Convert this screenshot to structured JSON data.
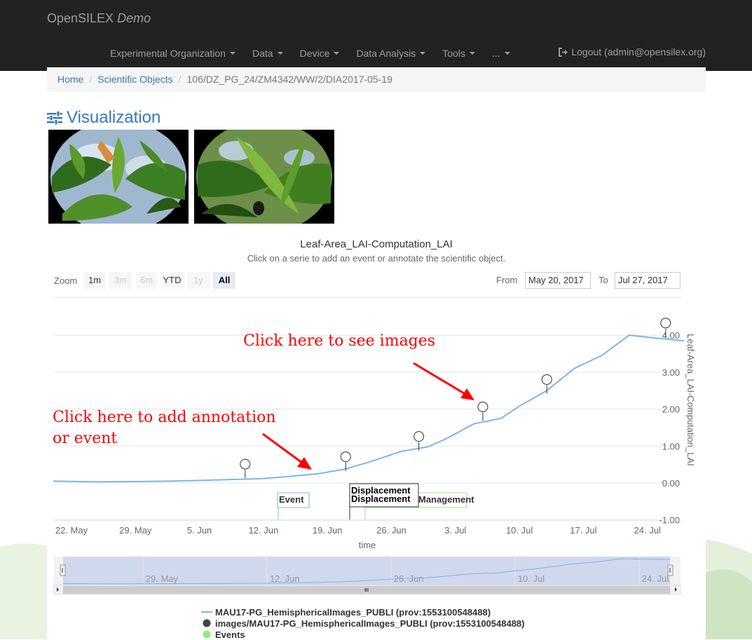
{
  "navbar": {
    "brand": "OpenSILEX",
    "brand_suffix": "Demo",
    "items": [
      {
        "label": "Experimental Organization"
      },
      {
        "label": "Data"
      },
      {
        "label": "Device"
      },
      {
        "label": "Data Analysis"
      },
      {
        "label": "Tools"
      },
      {
        "label": "..."
      }
    ],
    "logout": "Logout (admin@opensilex.org)"
  },
  "breadcrumb": {
    "home": "Home",
    "objects": "Scientific Objects",
    "current": "106/DZ_PG_24/ZM4342/WW/2/DIA2017-05-19"
  },
  "visualization": {
    "title": "Visualization"
  },
  "chart": {
    "title": "Leaf-Area_LAI-Computation_LAI",
    "subtitle": "Click on a serie to add an event or annotate the scientific object.",
    "zoom_label": "Zoom",
    "zoom_buttons": [
      "1m",
      "3m",
      "6m",
      "YTD",
      "1y",
      "All"
    ],
    "from_label": "From",
    "from_value": "May 20, 2017",
    "to_label": "To",
    "to_value": "Jul 27, 2017",
    "annotation_images": "Click here to see images",
    "annotation_event_line1": "Click here to add annotation",
    "annotation_event_line2": "or event",
    "colors": {
      "line": "#7cb5ec",
      "events": "#90ed7d",
      "navigator_fill": "#c9d4ec",
      "annotation": "#ff0000"
    }
  },
  "chart_data": {
    "type": "line",
    "title": "Leaf-Area_LAI-Computation_LAI",
    "xlabel": "time",
    "ylabel": "Leaf-Area_LAI-Computation_LAI",
    "ylim": [
      -1,
      4.3
    ],
    "y_ticks": [
      "-1.00",
      "0.00",
      "1.00",
      "2.00",
      "3.00",
      "4.00"
    ],
    "x_ticks": [
      "22. May",
      "29. May",
      "5. Jun",
      "12. Jun",
      "19. Jun",
      "26. Jun",
      "3. Jul",
      "10. Jul",
      "17. Jul",
      "24. Jul"
    ],
    "navigator_ticks": [
      "29. May",
      "12. Jun",
      "26. Jun",
      "10. Jul",
      "24. Jul"
    ],
    "series": [
      {
        "name": "MAU17-PG_HemisphericalImages_PUBLI (prov:1553100548488)",
        "x": [
          "2017-05-20",
          "2017-05-25",
          "2017-05-30",
          "2017-06-04",
          "2017-06-08",
          "2017-06-12",
          "2017-06-15",
          "2017-06-18",
          "2017-06-21",
          "2017-06-24",
          "2017-06-27",
          "2017-06-30",
          "2017-07-02",
          "2017-07-05",
          "2017-07-08",
          "2017-07-10",
          "2017-07-13",
          "2017-07-16",
          "2017-07-19",
          "2017-07-22",
          "2017-07-25",
          "2017-07-28"
        ],
        "values": [
          0.05,
          0.03,
          0.04,
          0.06,
          0.09,
          0.12,
          0.18,
          0.25,
          0.38,
          0.6,
          0.85,
          0.98,
          1.2,
          1.6,
          1.75,
          2.08,
          2.5,
          3.1,
          3.45,
          4.0,
          3.92,
          3.85
        ]
      },
      {
        "name": "images/MAU17-PG_HemisphericalImages_PUBLI (prov:1553100548488)",
        "x": [
          "2017-06-10",
          "2017-06-21",
          "2017-06-29",
          "2017-07-06",
          "2017-07-13",
          "2017-07-26"
        ],
        "values": [
          0.13,
          0.33,
          0.88,
          1.68,
          2.42,
          3.95
        ]
      }
    ],
    "events": [
      {
        "label": "Event",
        "date": "2017-06-13"
      },
      {
        "label": "Displacement",
        "date": "2017-06-21"
      },
      {
        "label": "Displacement",
        "date": "2017-06-21"
      },
      {
        "label": "Management",
        "date": "2017-06-23"
      }
    ]
  },
  "legend": [
    {
      "name": "MAU17-PG_HemisphericalImages_PUBLI (prov:1553100548488)",
      "symbol": "line",
      "color": "#7cb5ec"
    },
    {
      "name": "images/MAU17-PG_HemisphericalImages_PUBLI (prov:1553100548488)",
      "symbol": "circle",
      "color": "#434348"
    },
    {
      "name": "Events",
      "symbol": "circle",
      "color": "#90ed7d"
    }
  ]
}
